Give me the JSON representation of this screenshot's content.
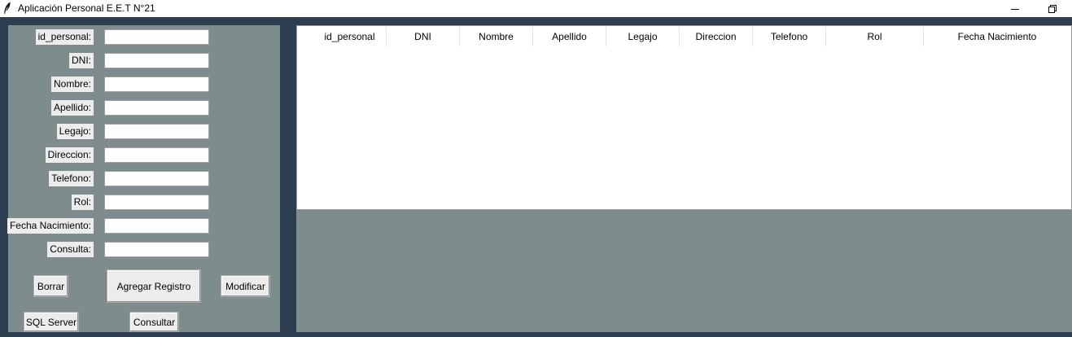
{
  "window": {
    "title": "Aplicación Personal E.E.T N°21",
    "minimize_label": "—",
    "restore_label": "❐",
    "icon": "feather-icon"
  },
  "form": {
    "fields": [
      {
        "label": "id_personal:",
        "value": ""
      },
      {
        "label": "DNI:",
        "value": ""
      },
      {
        "label": "Nombre:",
        "value": ""
      },
      {
        "label": "Apellido:",
        "value": ""
      },
      {
        "label": "Legajo:",
        "value": ""
      },
      {
        "label": "Direccion:",
        "value": ""
      },
      {
        "label": "Telefono:",
        "value": ""
      },
      {
        "label": "Rol:",
        "value": ""
      },
      {
        "label": "Fecha Nacimiento:",
        "value": ""
      },
      {
        "label": "Consulta:",
        "value": ""
      }
    ],
    "buttons": {
      "borrar": "Borrar",
      "agregar": "Agregar Registro",
      "modificar": "Modificar",
      "sql_server": "SQL Server",
      "consultar": "Consultar"
    }
  },
  "table": {
    "columns": [
      "id_personal",
      "DNI",
      "Nombre",
      "Apellido",
      "Legajo",
      "Direccion",
      "Telefono",
      "Rol",
      "Fecha Nacimiento"
    ],
    "rows": []
  },
  "colors": {
    "background": "#2c3e50",
    "panel": "#7f8c8d",
    "button": "#ececec"
  }
}
